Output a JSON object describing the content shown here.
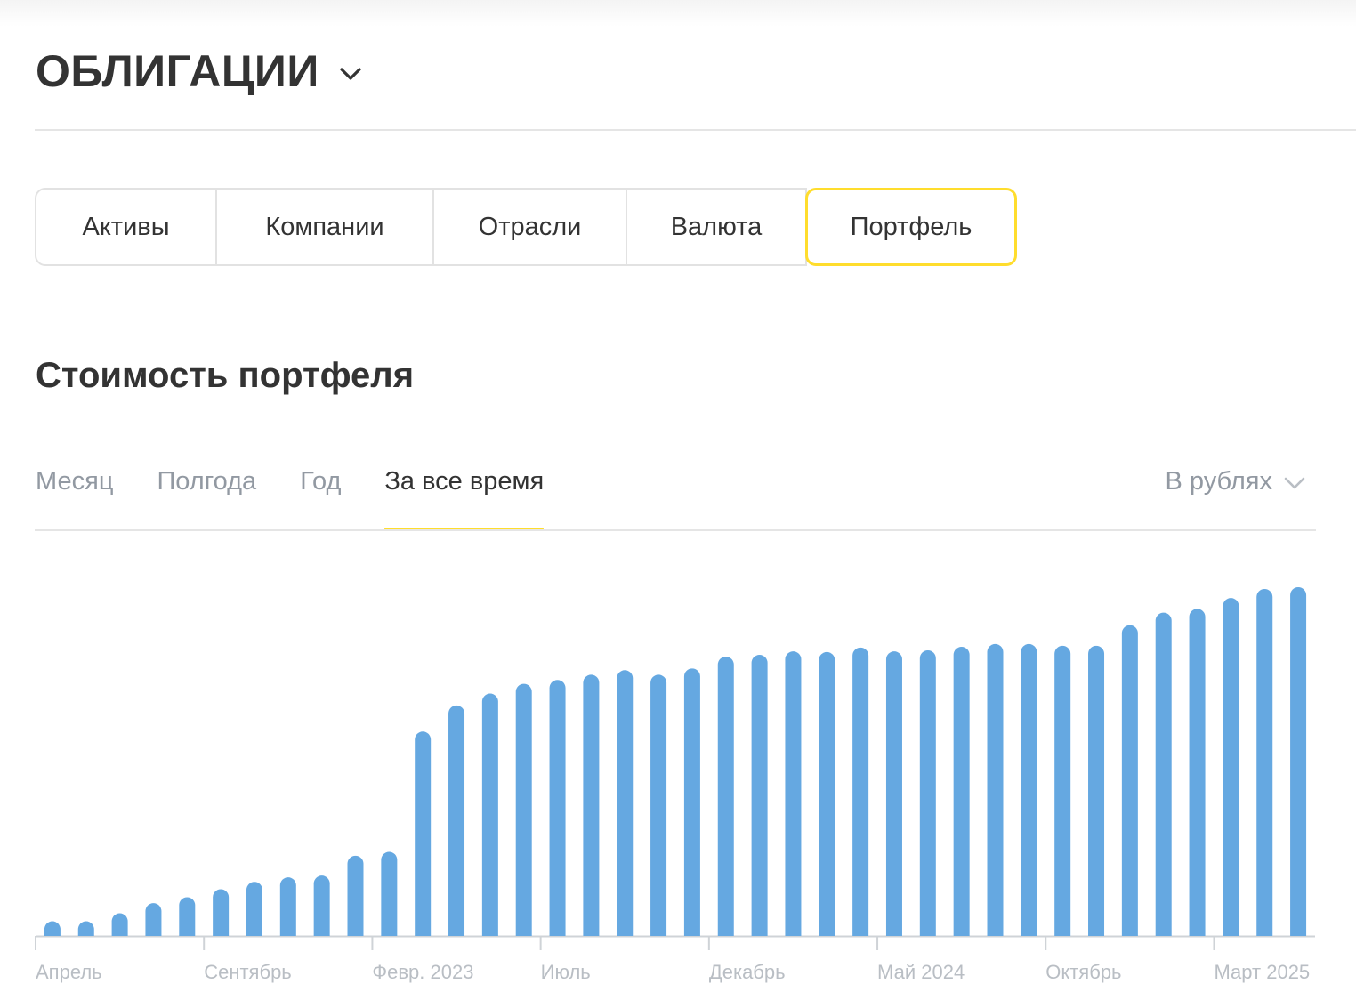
{
  "header": {
    "title": "ОБЛИГАЦИИ"
  },
  "tabs": [
    {
      "label": "Активы",
      "active": false
    },
    {
      "label": "Компании",
      "active": false
    },
    {
      "label": "Отрасли",
      "active": false
    },
    {
      "label": "Валюта",
      "active": false
    },
    {
      "label": "Портфель",
      "active": true
    }
  ],
  "section": {
    "title": "Стоимость портфеля"
  },
  "periods": [
    {
      "label": "Месяц",
      "active": false
    },
    {
      "label": "Полгода",
      "active": false
    },
    {
      "label": "Год",
      "active": false
    },
    {
      "label": "За все время",
      "active": true
    }
  ],
  "currency": {
    "label": "В рублях"
  },
  "colors": {
    "accent": "#ffdd2d",
    "bar": "#65a8e1",
    "text": "#333333",
    "muted": "#9299a2",
    "axis_label": "#b9bec4"
  },
  "icons": {
    "header_dropdown": "chevron-down-icon",
    "currency_dropdown": "chevron-down-icon"
  },
  "chart_data": {
    "type": "bar",
    "title": "",
    "xlabel": "",
    "ylabel": "",
    "y_axis_visible": false,
    "grid": false,
    "x_tick_labels": [
      "Апрель",
      "Сентябрь",
      "Февр. 2023",
      "Июль",
      "Декабрь",
      "Май 2024",
      "Октябрь",
      "Март 2025"
    ],
    "tick_every_n_bars": 5,
    "ylim": [
      0,
      100
    ],
    "values_note_relative_units": true,
    "values": [
      4.2,
      4.2,
      6.5,
      9.4,
      11.1,
      13.4,
      15.5,
      16.8,
      17.3,
      23.0,
      24.1,
      58.6,
      66.1,
      69.5,
      72.3,
      73.4,
      74.9,
      76.2,
      74.9,
      76.7,
      80.1,
      80.6,
      81.6,
      81.4,
      82.7,
      81.6,
      81.9,
      82.9,
      83.7,
      83.7,
      83.2,
      83.2,
      89.1,
      92.7,
      93.8,
      96.9,
      99.5,
      100.0
    ]
  }
}
